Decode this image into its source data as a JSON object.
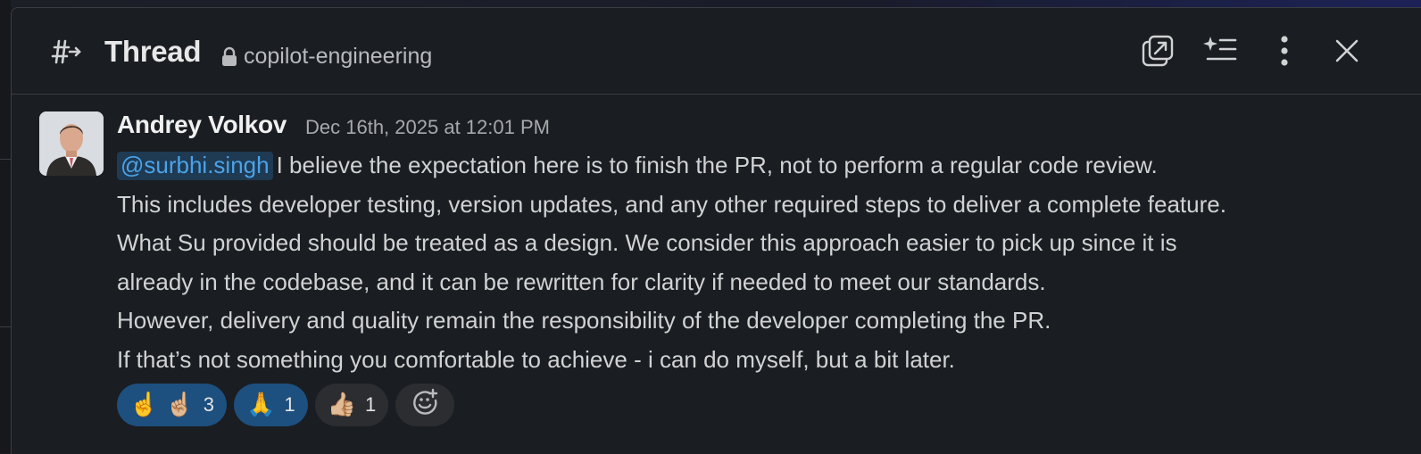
{
  "header": {
    "title": "Thread",
    "channel": "copilot-engineering",
    "icons": [
      "thread-channel-icon",
      "lock-icon",
      "open-in-window-icon",
      "ai-summary-icon",
      "more-options-icon",
      "close-icon"
    ]
  },
  "message": {
    "author": "Andrey Volkov",
    "timestamp": "Dec 16th, 2025 at 12:01 PM",
    "mention": "@surbhi.singh",
    "lines": [
      "I believe the expectation here is to finish the PR, not to perform a regular code review.",
      "This includes developer testing, version updates, and any other required steps to deliver a complete feature.",
      "What Su provided should be treated as a design. We consider this approach easier to pick up since it is",
      "already in the codebase, and it can be rewritten for clarity if needed to meet our standards.",
      "However, delivery and quality remain the responsibility of the developer completing the PR.",
      "If that’s not something you comfortable to achieve - i can do myself, but a bit later."
    ]
  },
  "reactions": [
    {
      "emoji": "☝️",
      "emoji2": "☝🏼",
      "count": "3",
      "active": true
    },
    {
      "emoji": "🙏",
      "count": "1",
      "active": true
    },
    {
      "emoji": "👍🏼",
      "count": "1",
      "active": false
    }
  ],
  "colors": {
    "background": "#1a1d21",
    "mention_bg": "#1f3a53",
    "mention_text": "#4aa3e8",
    "active_reaction": "#1d4f7f",
    "inactive_reaction": "#2b2d31"
  }
}
